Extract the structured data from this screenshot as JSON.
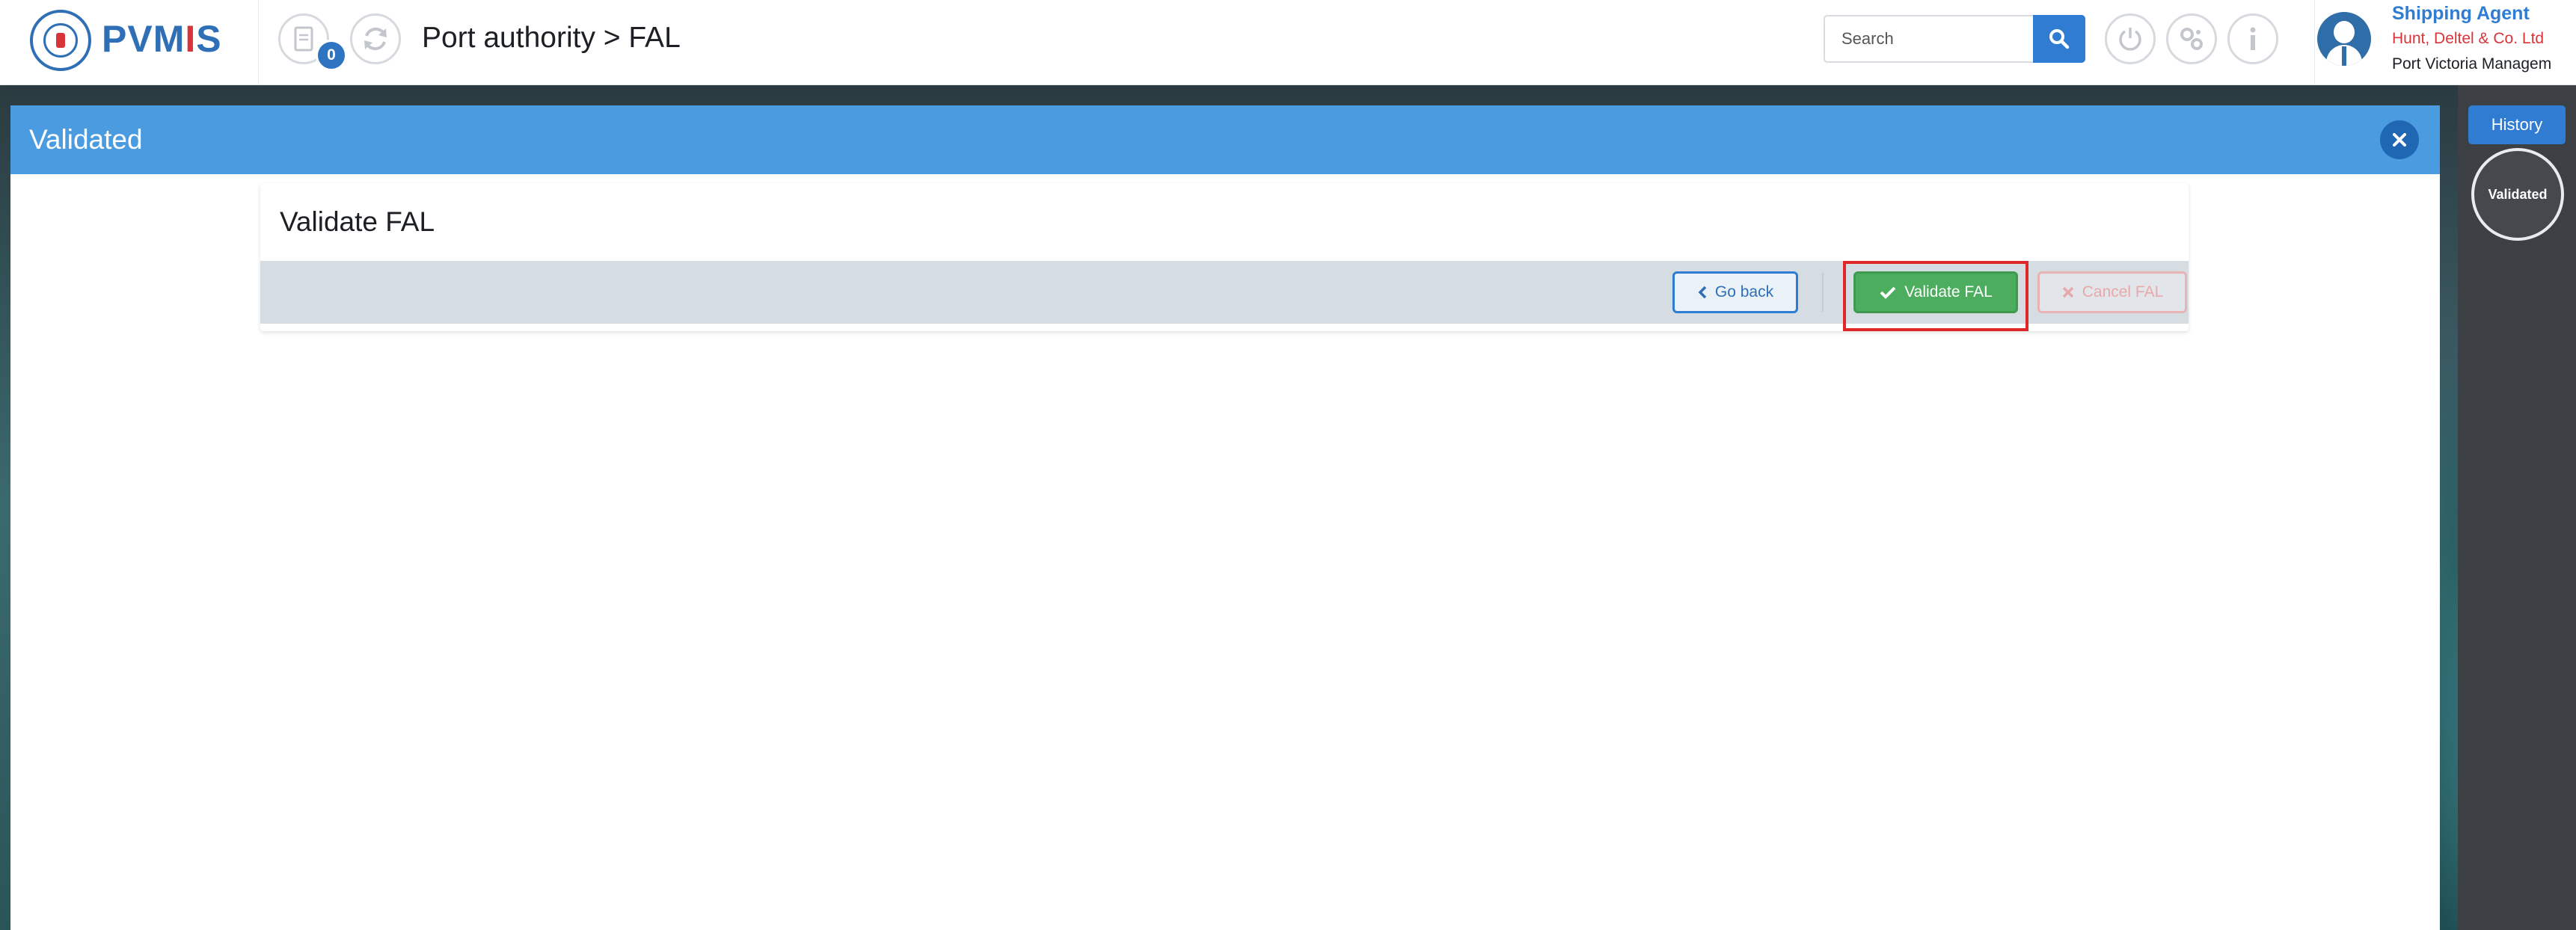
{
  "app": {
    "logo_text_left": "PVM",
    "logo_text_mid": "I",
    "logo_text_right": "S",
    "notification_count": "0",
    "title": "Port authority > FAL"
  },
  "search": {
    "placeholder": "Search",
    "value": ""
  },
  "user": {
    "role": "Shipping Agent",
    "company": "Hunt, Deltel & Co. Ltd",
    "organization": "Port Victoria Managem"
  },
  "modal": {
    "title": "Validated",
    "card_title": "Validate FAL",
    "go_back_label": "Go back",
    "validate_label": "Validate FAL",
    "cancel_label": "Cancel FAL"
  },
  "sidebar": {
    "history_label": "History",
    "status_label": "Validated"
  },
  "colors": {
    "primary": "#2f7cd2",
    "header_blue": "#4a9be0",
    "success": "#4cad5e",
    "highlight": "#e0272a",
    "danger": "#d9343a"
  },
  "icons": [
    "logo-emblem-icon",
    "document-icon",
    "refresh-icon",
    "search-icon",
    "power-icon",
    "settings-icon",
    "info-icon",
    "user-avatar-icon",
    "close-icon",
    "chevron-left-icon",
    "check-icon",
    "x-icon"
  ]
}
